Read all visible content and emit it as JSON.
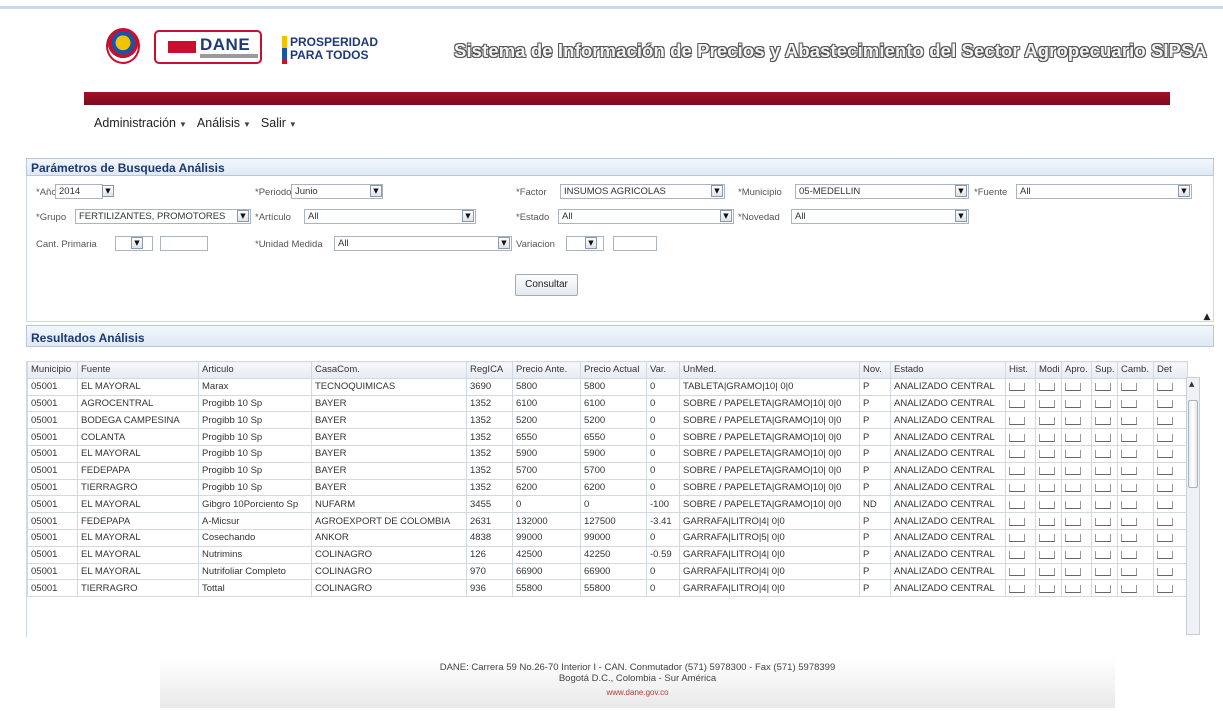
{
  "header": {
    "logo_dane": "DANE",
    "logo_prosperidad_1": "PROSPERIDAD",
    "logo_prosperidad_2": "PARA TODOS",
    "system_title": "Sistema de Información de Precios y Abastecimiento del Sector Agropecuario SIPSA"
  },
  "menu": {
    "items": [
      "Administración",
      "Análisis",
      "Salir"
    ]
  },
  "params": {
    "title": "Parámetros de Busqueda Análisis",
    "anio_label": "*Año",
    "anio_value": "2014",
    "periodo_label": "*Periodo",
    "periodo_value": "Junio",
    "factor_label": "*Factor",
    "factor_value": "INSUMOS AGRICOLAS",
    "municipio_label": "*Municipio",
    "municipio_value": "05-MEDELLIN",
    "fuente_label": "*Fuente",
    "fuente_value": "All",
    "grupo_label": "*Grupo",
    "grupo_value": "FERTILIZANTES, PROMOTORES",
    "articulo_label": "*Artículo",
    "articulo_value": "All",
    "estado_label": "*Estado",
    "estado_value": "All",
    "novedad_label": "*Novedad",
    "novedad_value": "All",
    "cant_label": "Cant. Primaria",
    "unidad_label": "*Unidad Medida",
    "unidad_value": "All",
    "variacion_label": "Variacion",
    "consultar_label": "Consultar"
  },
  "results": {
    "title": "Resultados Análisis",
    "columns": [
      "Municipio",
      "Fuente",
      "Articulo",
      "CasaCom.",
      "RegICA",
      "Precio Ante.",
      "Precio Actual",
      "Var.",
      "UnMed.",
      "Nov.",
      "Estado",
      "Hist.",
      "Modi",
      "Apro.",
      "Sup.",
      "Camb.",
      "Det"
    ],
    "rows": [
      [
        "05001",
        "EL MAYORAL",
        "Marax",
        "TECNOQUIMICAS",
        "3690",
        "5800",
        "5800",
        "0",
        "TABLETA|GRAMO|10| 0|0",
        "P",
        "ANALIZADO CENTRAL"
      ],
      [
        "05001",
        "AGROCENTRAL",
        "Progibb 10 Sp",
        "BAYER",
        "1352",
        "6100",
        "6100",
        "0",
        "SOBRE / PAPELETA|GRAMO|10| 0|0",
        "P",
        "ANALIZADO CENTRAL"
      ],
      [
        "05001",
        "BODEGA CAMPESINA",
        "Progibb 10 Sp",
        "BAYER",
        "1352",
        "5200",
        "5200",
        "0",
        "SOBRE / PAPELETA|GRAMO|10| 0|0",
        "P",
        "ANALIZADO CENTRAL"
      ],
      [
        "05001",
        "COLANTA",
        "Progibb 10 Sp",
        "BAYER",
        "1352",
        "6550",
        "6550",
        "0",
        "SOBRE / PAPELETA|GRAMO|10| 0|0",
        "P",
        "ANALIZADO CENTRAL"
      ],
      [
        "05001",
        "EL MAYORAL",
        "Progibb 10 Sp",
        "BAYER",
        "1352",
        "5900",
        "5900",
        "0",
        "SOBRE / PAPELETA|GRAMO|10| 0|0",
        "P",
        "ANALIZADO CENTRAL"
      ],
      [
        "05001",
        "FEDEPAPA",
        "Progibb 10 Sp",
        "BAYER",
        "1352",
        "5700",
        "5700",
        "0",
        "SOBRE / PAPELETA|GRAMO|10| 0|0",
        "P",
        "ANALIZADO CENTRAL"
      ],
      [
        "05001",
        "TIERRAGRO",
        "Progibb 10 Sp",
        "BAYER",
        "1352",
        "6200",
        "6200",
        "0",
        "SOBRE / PAPELETA|GRAMO|10| 0|0",
        "P",
        "ANALIZADO CENTRAL"
      ],
      [
        "05001",
        "EL MAYORAL",
        "Gibgro 10Porciento Sp",
        "NUFARM",
        "3455",
        "0",
        "0",
        "-100",
        "SOBRE / PAPELETA|GRAMO|10| 0|0",
        "ND",
        "ANALIZADO CENTRAL"
      ],
      [
        "05001",
        "FEDEPAPA",
        "A-Micsur",
        "AGROEXPORT DE COLOMBIA",
        "2631",
        "132000",
        "127500",
        "-3.41",
        "GARRAFA|LITRO|4| 0|0",
        "P",
        "ANALIZADO CENTRAL"
      ],
      [
        "05001",
        "EL MAYORAL",
        "Cosechando",
        "ANKOR",
        "4838",
        "99000",
        "99000",
        "0",
        "GARRAFA|LITRO|5| 0|0",
        "P",
        "ANALIZADO CENTRAL"
      ],
      [
        "05001",
        "EL MAYORAL",
        "Nutrimins",
        "COLINAGRO",
        "126",
        "42500",
        "42250",
        "-0.59",
        "GARRAFA|LITRO|4| 0|0",
        "P",
        "ANALIZADO CENTRAL"
      ],
      [
        "05001",
        "EL MAYORAL",
        "Nutrifoliar Completo",
        "COLINAGRO",
        "970",
        "66900",
        "66900",
        "0",
        "GARRAFA|LITRO|4| 0|0",
        "P",
        "ANALIZADO CENTRAL"
      ],
      [
        "05001",
        "TIERRAGRO",
        "Tottal",
        "COLINAGRO",
        "936",
        "55800",
        "55800",
        "0",
        "GARRAFA|LITRO|4| 0|0",
        "P",
        "ANALIZADO CENTRAL"
      ]
    ]
  },
  "footer": {
    "line1": "DANE: Carrera 59 No.26-70 Interior I - CAN. Conmutador (571) 5978300 - Fax (571) 5978399",
    "line2": "Bogotá D.C., Colombia - Sur América",
    "line3": "www.dane.gov.co"
  }
}
